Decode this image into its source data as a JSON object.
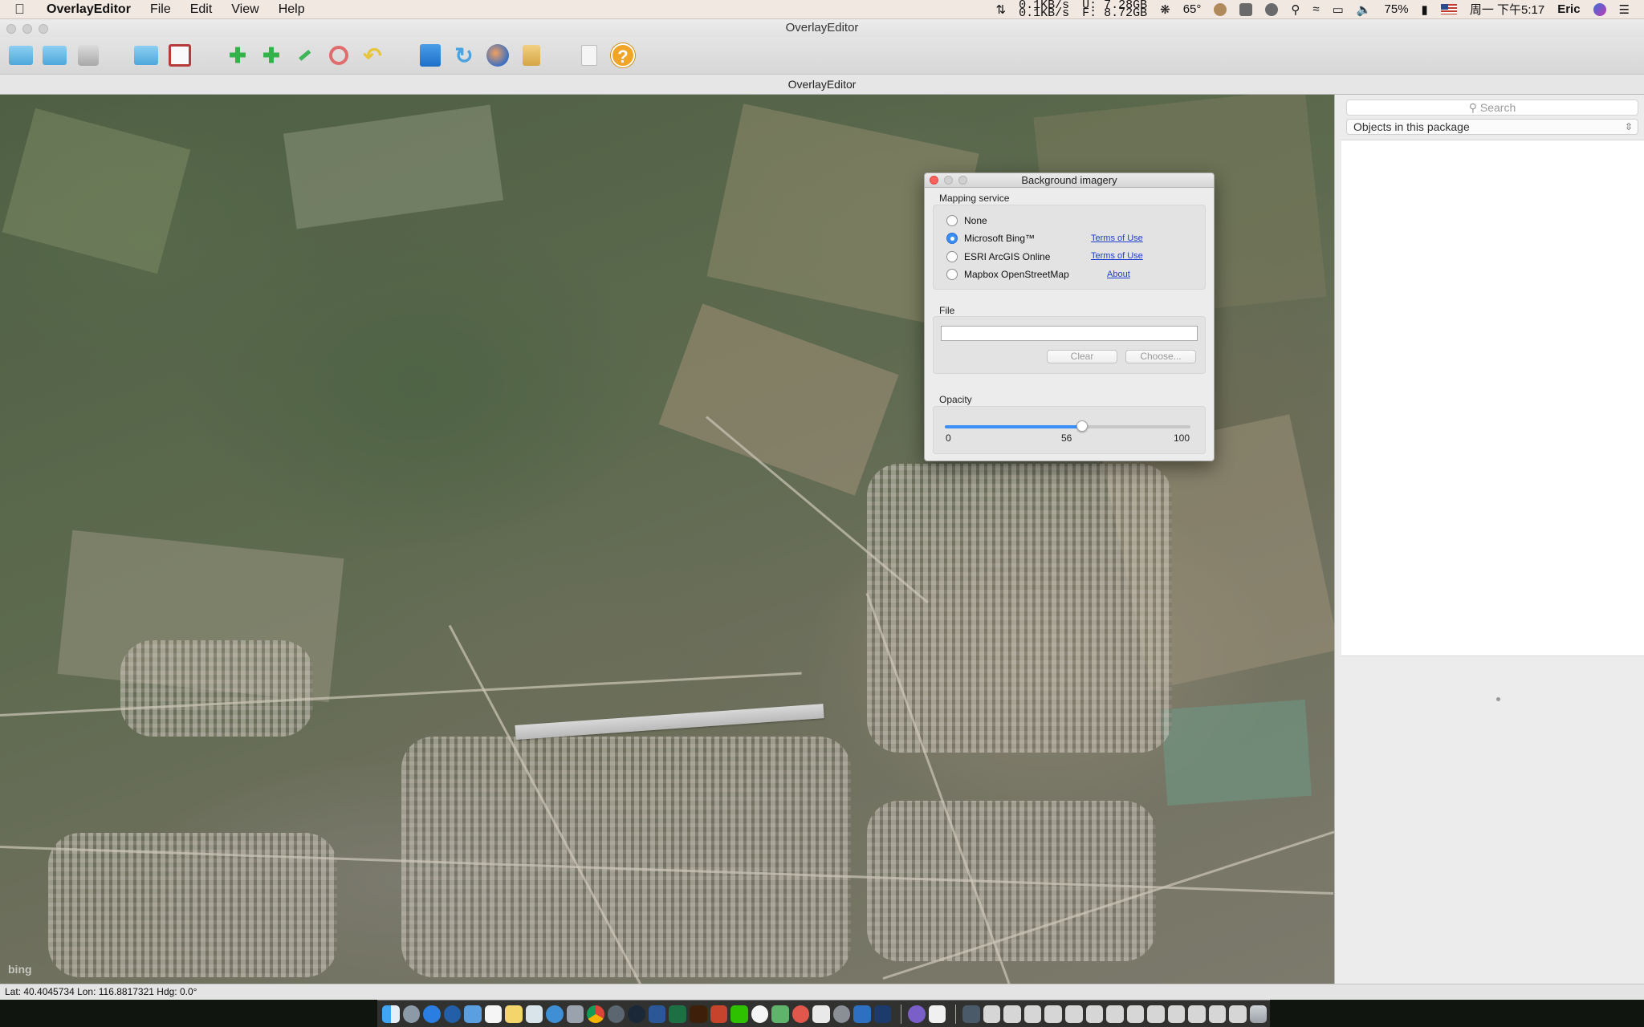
{
  "menubar": {
    "app_name": "OverlayEditor",
    "menus": [
      "File",
      "Edit",
      "View",
      "Help"
    ],
    "net_up": "0.1KB/s",
    "net_down": "0.1KB/s",
    "mem_u": "U: 7.28GB",
    "mem_f": "F: 8.72GB",
    "temperature": "65°",
    "battery": "75%",
    "clock": "周一 下午5:17",
    "user": "Eric"
  },
  "window": {
    "title": "OverlayEditor",
    "subtitle": "OverlayEditor"
  },
  "toolbar": {
    "icons": [
      "new-package-icon",
      "open-folder-icon",
      "save-icon",
      "import-folder-icon",
      "import-image-icon",
      "add-object-icon",
      "add-polygon-icon",
      "edit-wand-icon",
      "delete-icon",
      "undo-icon",
      "home-icon",
      "refresh-icon",
      "globe-icon",
      "lock-icon",
      "blank-doc-icon",
      "help-icon"
    ],
    "help_label": "?"
  },
  "sidepanel": {
    "search_placeholder": "Search",
    "package_selector": "Objects in this package"
  },
  "dialog": {
    "title": "Background imagery",
    "mapping_label": "Mapping service",
    "services": [
      {
        "label": "None",
        "selected": false,
        "link": ""
      },
      {
        "label": "Microsoft Bing™",
        "selected": true,
        "link": "Terms of Use"
      },
      {
        "label": "ESRI ArcGIS Online",
        "selected": false,
        "link": "Terms of Use"
      },
      {
        "label": "Mapbox OpenStreetMap",
        "selected": false,
        "link": "About"
      }
    ],
    "file_label": "File",
    "file_value": "",
    "clear_button": "Clear",
    "choose_button": "Choose...",
    "opacity_label": "Opacity",
    "opacity_value": 56,
    "opacity_min": "0",
    "opacity_current": "56",
    "opacity_max": "100"
  },
  "map": {
    "attribution": "bing"
  },
  "statusbar": {
    "coords": "Lat: 40.4045734  Lon: 116.8817321  Hdg: 0.0°"
  },
  "colors": {
    "accent": "#3b8ef5",
    "link": "#1f3fcc",
    "close_button": "#fc605b"
  }
}
